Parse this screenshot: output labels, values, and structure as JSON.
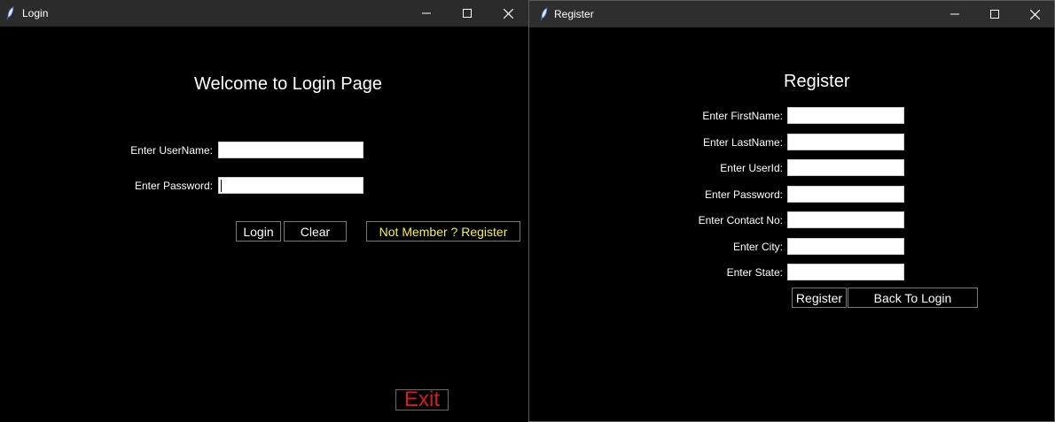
{
  "login_window": {
    "title": "Login",
    "heading": "Welcome to Login Page",
    "username_label": "Enter UserName:",
    "password_label": "Enter Password:",
    "username_value": "",
    "password_value": "",
    "login_button": "Login",
    "clear_button": "Clear",
    "register_link": "Not Member ? Register",
    "exit_button": "Exit"
  },
  "register_window": {
    "title": "Register",
    "heading": "Register",
    "fields": [
      {
        "label": "Enter FirstName:",
        "value": ""
      },
      {
        "label": "Enter LastName:",
        "value": ""
      },
      {
        "label": "Enter UserId:",
        "value": ""
      },
      {
        "label": "Enter Password:",
        "value": ""
      },
      {
        "label": "Enter Contact No:",
        "value": ""
      },
      {
        "label": "Enter City:",
        "value": ""
      },
      {
        "label": "Enter State:",
        "value": ""
      }
    ],
    "register_button": "Register",
    "back_button": "Back To Login"
  },
  "colors": {
    "background": "#000000",
    "titlebar": "#2b2b2b",
    "register_link_text": "#f2ef5a",
    "exit_text": "#d32020"
  },
  "icons": {
    "app_icon": "feather-icon",
    "minimize": "minimize-icon",
    "maximize": "maximize-icon",
    "close": "close-icon"
  }
}
